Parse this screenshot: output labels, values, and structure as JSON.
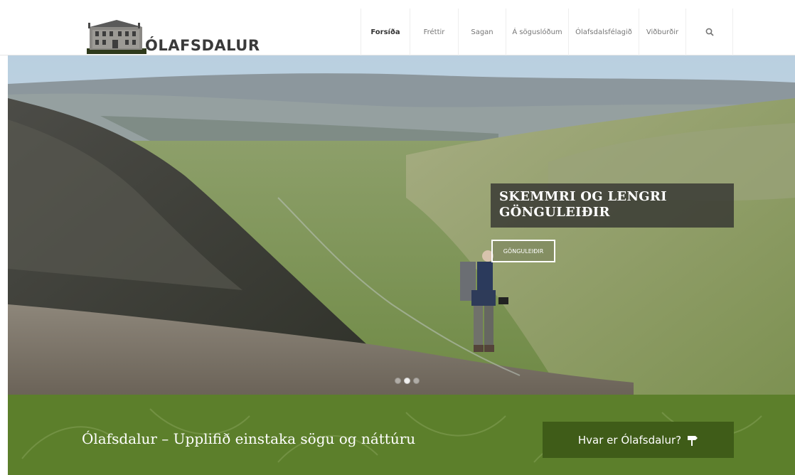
{
  "logo": {
    "text": "ÓLAFSDALUR",
    "icon": "house-logo-icon"
  },
  "nav": {
    "items": [
      {
        "label": "Forsíða",
        "active": true
      },
      {
        "label": "Fréttir",
        "active": false
      },
      {
        "label": "Sagan",
        "active": false
      },
      {
        "label": "Á söguslóðum",
        "active": false
      },
      {
        "label": "Ólafsdalsfélagið",
        "active": false
      },
      {
        "label": "Viðburðir",
        "active": false
      }
    ],
    "search_icon": "search-icon"
  },
  "hero": {
    "caption_title_line1": "SKEMMRI OG LENGRI",
    "caption_title_line2": "GÖNGULEIÐIR",
    "button_label": "GÖNGULEIÐIR",
    "slide_count": 3,
    "active_slide": 2
  },
  "band": {
    "tagline": "Ólafsdalur – Upplifið einstaka sögu og náttúru",
    "button_label": "Hvar er Ólafsdalur?",
    "button_icon": "signpost-icon",
    "color": "#5c7f2b",
    "button_color": "#3f5c18"
  }
}
